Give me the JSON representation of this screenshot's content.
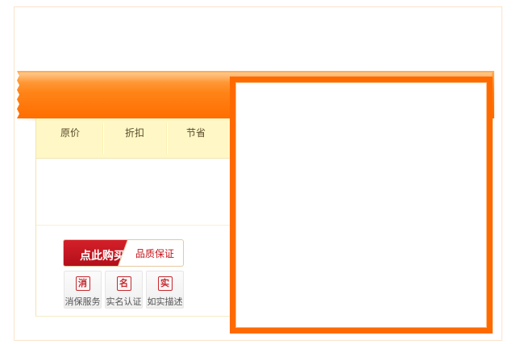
{
  "price_table": {
    "headers": [
      "原价",
      "折扣",
      "节省"
    ]
  },
  "purchase": {
    "buy_label": "点此购买",
    "guarantee_label": "品质保证"
  },
  "badges": [
    {
      "icon": "消",
      "label": "消保服务",
      "icon_name": "consumer-protection-icon"
    },
    {
      "icon": "名",
      "label": "实名认证",
      "icon_name": "verified-name-icon"
    },
    {
      "icon": "实",
      "label": "如实描述",
      "icon_name": "accurate-description-icon"
    }
  ],
  "colors": {
    "accent_orange": "#ff6a00",
    "buy_red": "#c4141b",
    "header_yellow": "#fff8c6"
  }
}
